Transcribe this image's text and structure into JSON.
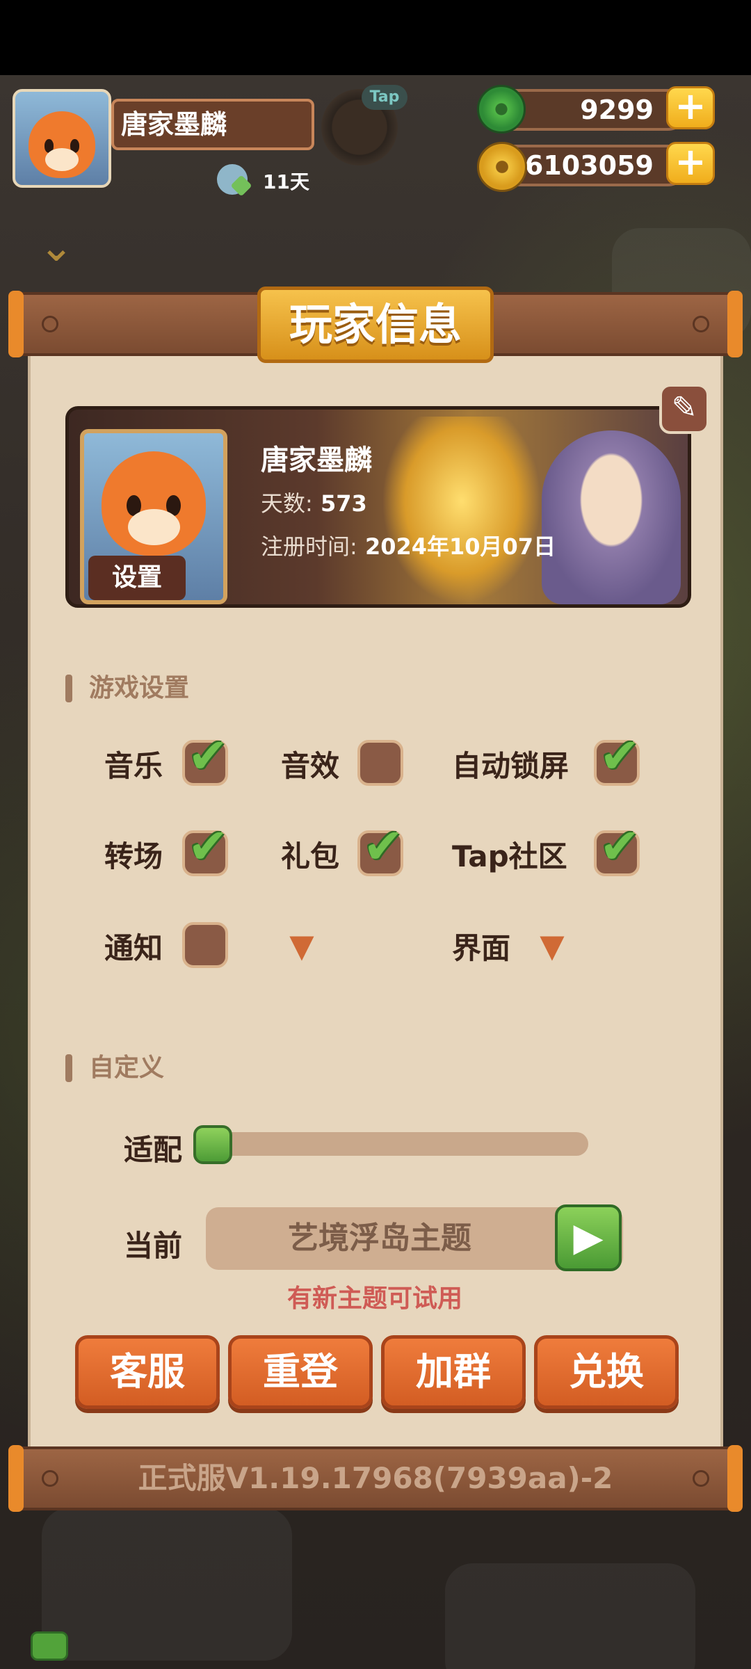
{
  "hud": {
    "player_name": "唐家墨麟",
    "days_label": "11天",
    "tap_badge": "Tap",
    "jade_amount": "9299",
    "coin_amount": "76103059",
    "plus_symbol": "+"
  },
  "panel": {
    "title": "玩家信息",
    "profile": {
      "name": "唐家墨麟",
      "days_prefix": "天数:",
      "days_value": " 573",
      "reg_prefix": "注册时间:",
      "reg_value": " 2024年10月07日",
      "settings_label": "设置"
    },
    "game_settings": {
      "title": "游戏设置",
      "items": [
        {
          "label": "音乐",
          "checked": true
        },
        {
          "label": "音效",
          "checked": false
        },
        {
          "label": "自动锁屏",
          "checked": true
        },
        {
          "label": "转场",
          "checked": true
        },
        {
          "label": "礼包",
          "checked": true
        },
        {
          "label": "Tap社区",
          "checked": true
        },
        {
          "label": "通知",
          "checked": false
        },
        {
          "label": "界面",
          "dropdown": true
        }
      ]
    },
    "custom": {
      "title": "自定义",
      "fit_label": "适配",
      "fit_value": 0,
      "current_label": "当前",
      "theme_name": "艺境浮岛主题",
      "theme_hint": "有新主题可试用"
    },
    "buttons": {
      "support": "客服",
      "relogin": "重登",
      "join_group": "加群",
      "redeem": "兑换"
    },
    "version": "正式服V1.19.17968(7939aa)-2"
  },
  "colors": {
    "accent_orange": "#d35d23",
    "accent_green": "#6fc04c",
    "panel_bg": "#e7d6bd",
    "wood": "#7b4b31"
  },
  "icons": {
    "edit": "edit-icon",
    "check": "check-icon",
    "play": "play-icon",
    "dropdown": "chevron-down-icon"
  }
}
